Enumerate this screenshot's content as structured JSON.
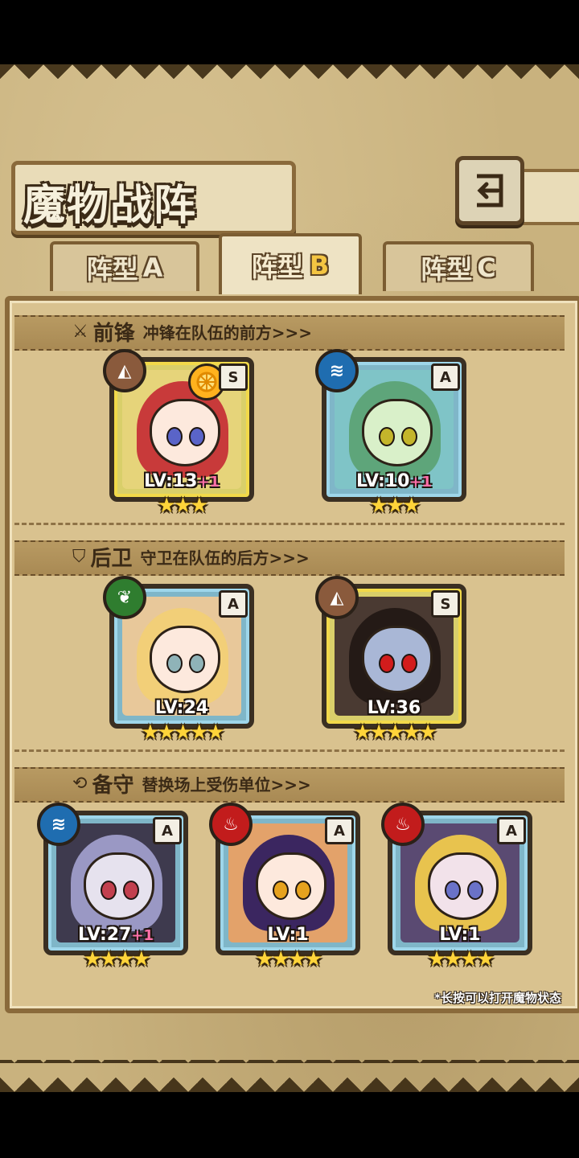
{
  "title": "魔物战阵",
  "tabs": [
    {
      "prefix": "阵型",
      "letter": "A",
      "active": false
    },
    {
      "prefix": "阵型",
      "letter": "B",
      "active": true
    },
    {
      "prefix": "阵型",
      "letter": "C",
      "active": false
    }
  ],
  "sections": {
    "front": {
      "name": "前锋",
      "desc": "冲锋在队伍的前方>>>",
      "icon": "sword-icon"
    },
    "back": {
      "name": "后卫",
      "desc": "守卫在队伍的后方>>>",
      "icon": "shield-icon"
    },
    "reserve": {
      "name": "备守",
      "desc": "替换场上受伤单位>>>",
      "icon": "swap-icon"
    }
  },
  "monsters": {
    "f1": {
      "element": "earth",
      "rank": "S",
      "lv": "LV:13",
      "plus": "+1",
      "stars": "★★★",
      "stars_count": 3,
      "frame": "gold",
      "bonus_icon": "orange-slice-icon"
    },
    "f2": {
      "element": "water",
      "rank": "A",
      "lv": "LV:10",
      "plus": "+1",
      "stars": "★★★",
      "stars_count": 3,
      "frame": "blue"
    },
    "b1": {
      "element": "nature",
      "rank": "A",
      "lv": "LV:24",
      "plus": "",
      "stars": "★★★★★",
      "stars_count": 5,
      "frame": "blue"
    },
    "b2": {
      "element": "earth",
      "rank": "S",
      "lv": "LV:36",
      "plus": "",
      "stars": "★★★★★",
      "stars_count": 5,
      "frame": "gold"
    },
    "r1": {
      "element": "water",
      "rank": "A",
      "lv": "LV:27",
      "plus": "+1",
      "stars": "★★★★",
      "stars_count": 4,
      "frame": "blue"
    },
    "r2": {
      "element": "fire",
      "rank": "A",
      "lv": "LV:1",
      "plus": "",
      "stars": "★★★★",
      "stars_count": 4,
      "frame": "blue"
    },
    "r3": {
      "element": "fire",
      "rank": "A",
      "lv": "LV:1",
      "plus": "",
      "stars": "★★★★",
      "stars_count": 4,
      "frame": "blue"
    }
  },
  "hint": "*长按可以打开魔物状态",
  "colors": {
    "earth": "#8a5a3c",
    "water": "#1f6db0",
    "nature": "#2f7d2f",
    "fire": "#c21c1c",
    "star": "#ffd43a",
    "plus": "#ff6fa8"
  }
}
